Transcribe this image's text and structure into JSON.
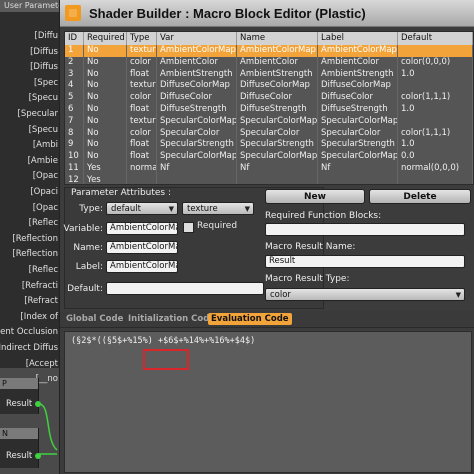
{
  "background_node": {
    "header": "User Parameter",
    "ports": [
      "[Diffu",
      "[Diffus",
      "[Diffus",
      "[Spec",
      "[Specu",
      "[Specular",
      "[Specu",
      "[Ambi",
      "[Ambie",
      "[Opac",
      "[Opaci",
      "[Opac",
      "[Reflec",
      "[Reflection",
      "[Reflection",
      "[Reflec",
      "[Refracti",
      "[Refract",
      "[Index of",
      "mbient Occlusion",
      "[Indirect Diffus",
      "[Accept",
      "[__no"
    ],
    "node2": {
      "title": "P",
      "port": "Result"
    },
    "node3": {
      "title": "N",
      "port": "Result"
    }
  },
  "window": {
    "title": "Shader Builder : Macro Block Editor (Plastic)"
  },
  "table": {
    "columns": [
      "ID",
      "Required",
      "Type",
      "Var",
      "Name",
      "Label",
      "Default"
    ],
    "rows": [
      [
        "1",
        "No",
        "texture",
        "AmbientColorMap",
        "AmbientColorMap",
        "AmbientColorMap",
        ""
      ],
      [
        "2",
        "No",
        "color",
        "AmbientColor",
        "AmbientColor",
        "AmbientColor",
        "color(0,0,0)"
      ],
      [
        "3",
        "No",
        "float",
        "AmbientStrength",
        "AmbientStrength",
        "AmbientStrength",
        "1.0"
      ],
      [
        "4",
        "No",
        "texture",
        "DiffuseColorMap",
        "DiffuseColorMap",
        "DiffuseColorMap",
        ""
      ],
      [
        "5",
        "No",
        "color",
        "DiffuseColor",
        "DiffuseColor",
        "DiffuseColor",
        "color(1,1,1)"
      ],
      [
        "6",
        "No",
        "float",
        "DiffuseStrength",
        "DiffuseStrength",
        "DiffuseStrength",
        "1.0"
      ],
      [
        "7",
        "No",
        "texture",
        "SpecularColorMap",
        "SpecularColorMap",
        "SpecularColorMap",
        ""
      ],
      [
        "8",
        "No",
        "color",
        "SpecularColor",
        "SpecularColor",
        "SpecularColor",
        "color(1,1,1)"
      ],
      [
        "9",
        "No",
        "float",
        "SpecularStrength",
        "SpecularStrength",
        "SpecularStrength",
        "1.0"
      ],
      [
        "10",
        "No",
        "float",
        "SpecularColorMapBlur",
        "SpecularColorMapBlur",
        "SpecularColorMapBlur",
        "0.0"
      ],
      [
        "11",
        "Yes",
        "normal",
        "Nf",
        "Nf",
        "Nf",
        "normal(0,0,0)"
      ],
      [
        "12",
        "Yes",
        "",
        "",
        "",
        "",
        ""
      ]
    ],
    "selected_row": 0
  },
  "attributes": {
    "group_title": "Parameter Attributes :",
    "type_label": "Type:",
    "type_value": "default",
    "type2_value": "texture",
    "required_label": "Required",
    "variable_label": "Variable:",
    "variable_value": "AmbientColorMap",
    "name_label": "Name:",
    "name_value": "AmbientColorMap",
    "label_label": "Label:",
    "label_value": "AmbientColorMap",
    "default_label": "Default:",
    "default_value": ""
  },
  "right_panel": {
    "new_label": "New",
    "delete_label": "Delete",
    "required_blocks_label": "Required Function Blocks:",
    "required_blocks_value": "",
    "result_name_label": "Macro Result Name:",
    "result_name_value": "Result",
    "result_type_label": "Macro Result Type:",
    "result_type_value": "color"
  },
  "tabs": [
    "Global Code",
    "Initialization Code",
    "Evaluation Code"
  ],
  "active_tab": 2,
  "code": {
    "line": "(§2$*((§5$+%15%) +$6$+%14%+%16%+$4$)"
  },
  "colors": {
    "accent": "#f2a33a",
    "highlight_box": "#d8262a"
  }
}
